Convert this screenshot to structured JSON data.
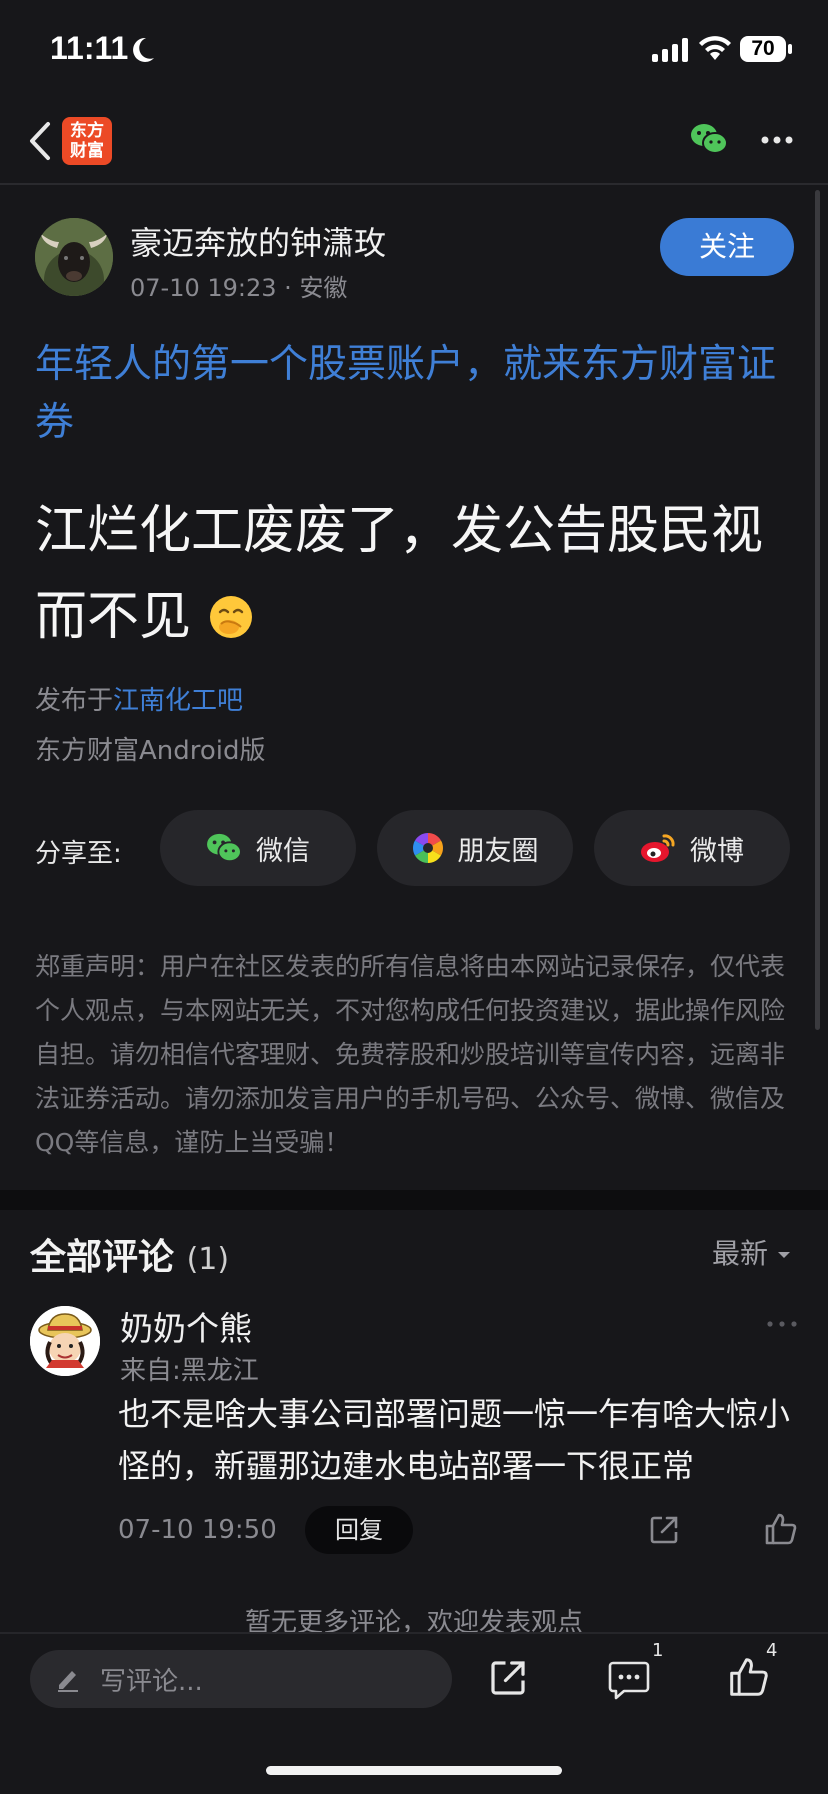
{
  "status_bar": {
    "time": "11:11",
    "battery": "70"
  },
  "nav": {
    "logo_text": "东方财富"
  },
  "post": {
    "author": "豪迈奔放的钟潇玫",
    "date": "07-10 19:23",
    "location": "安徽",
    "follow_label": "关注",
    "promo": "年轻人的第一个股票账户，就来东方财富证券",
    "title": "江烂化工废废了，发公告股民视而不见",
    "title_emoji": "🤭",
    "published_prefix": "发布于",
    "published_board": "江南化工吧",
    "client": "东方财富Android版"
  },
  "share": {
    "label": "分享至:",
    "wechat": "微信",
    "moments": "朋友圈",
    "weibo": "微博"
  },
  "disclaimer": "郑重声明：用户在社区发表的所有信息将由本网站记录保存，仅代表个人观点，与本网站无关，不对您构成任何投资建议，据此操作风险自担。请勿相信代客理财、免费荐股和炒股培训等宣传内容，远离非法证券活动。请勿添加发言用户的手机号码、公众号、微博、微信及QQ等信息，谨防上当受骗！",
  "comments": {
    "header": "全部评论",
    "count": "(1)",
    "sort": "最新",
    "items": [
      {
        "name": "奶奶个熊",
        "from": "来自:黑龙江",
        "text": "也不是啥大事公司部署问题一惊一乍有啥大惊小怪的，新疆那边建水电站部署一下很正常",
        "time": "07-10 19:50",
        "reply_label": "回复"
      }
    ],
    "no_more": "暂无更多评论，欢迎发表观点"
  },
  "bottom_bar": {
    "placeholder": "写评论...",
    "comment_count": "1",
    "like_count": "4"
  },
  "colors": {
    "accent": "#3f7fd6",
    "follow_button": "#3a7bd5",
    "logo": "#ec4a26",
    "background": "#17171a"
  }
}
